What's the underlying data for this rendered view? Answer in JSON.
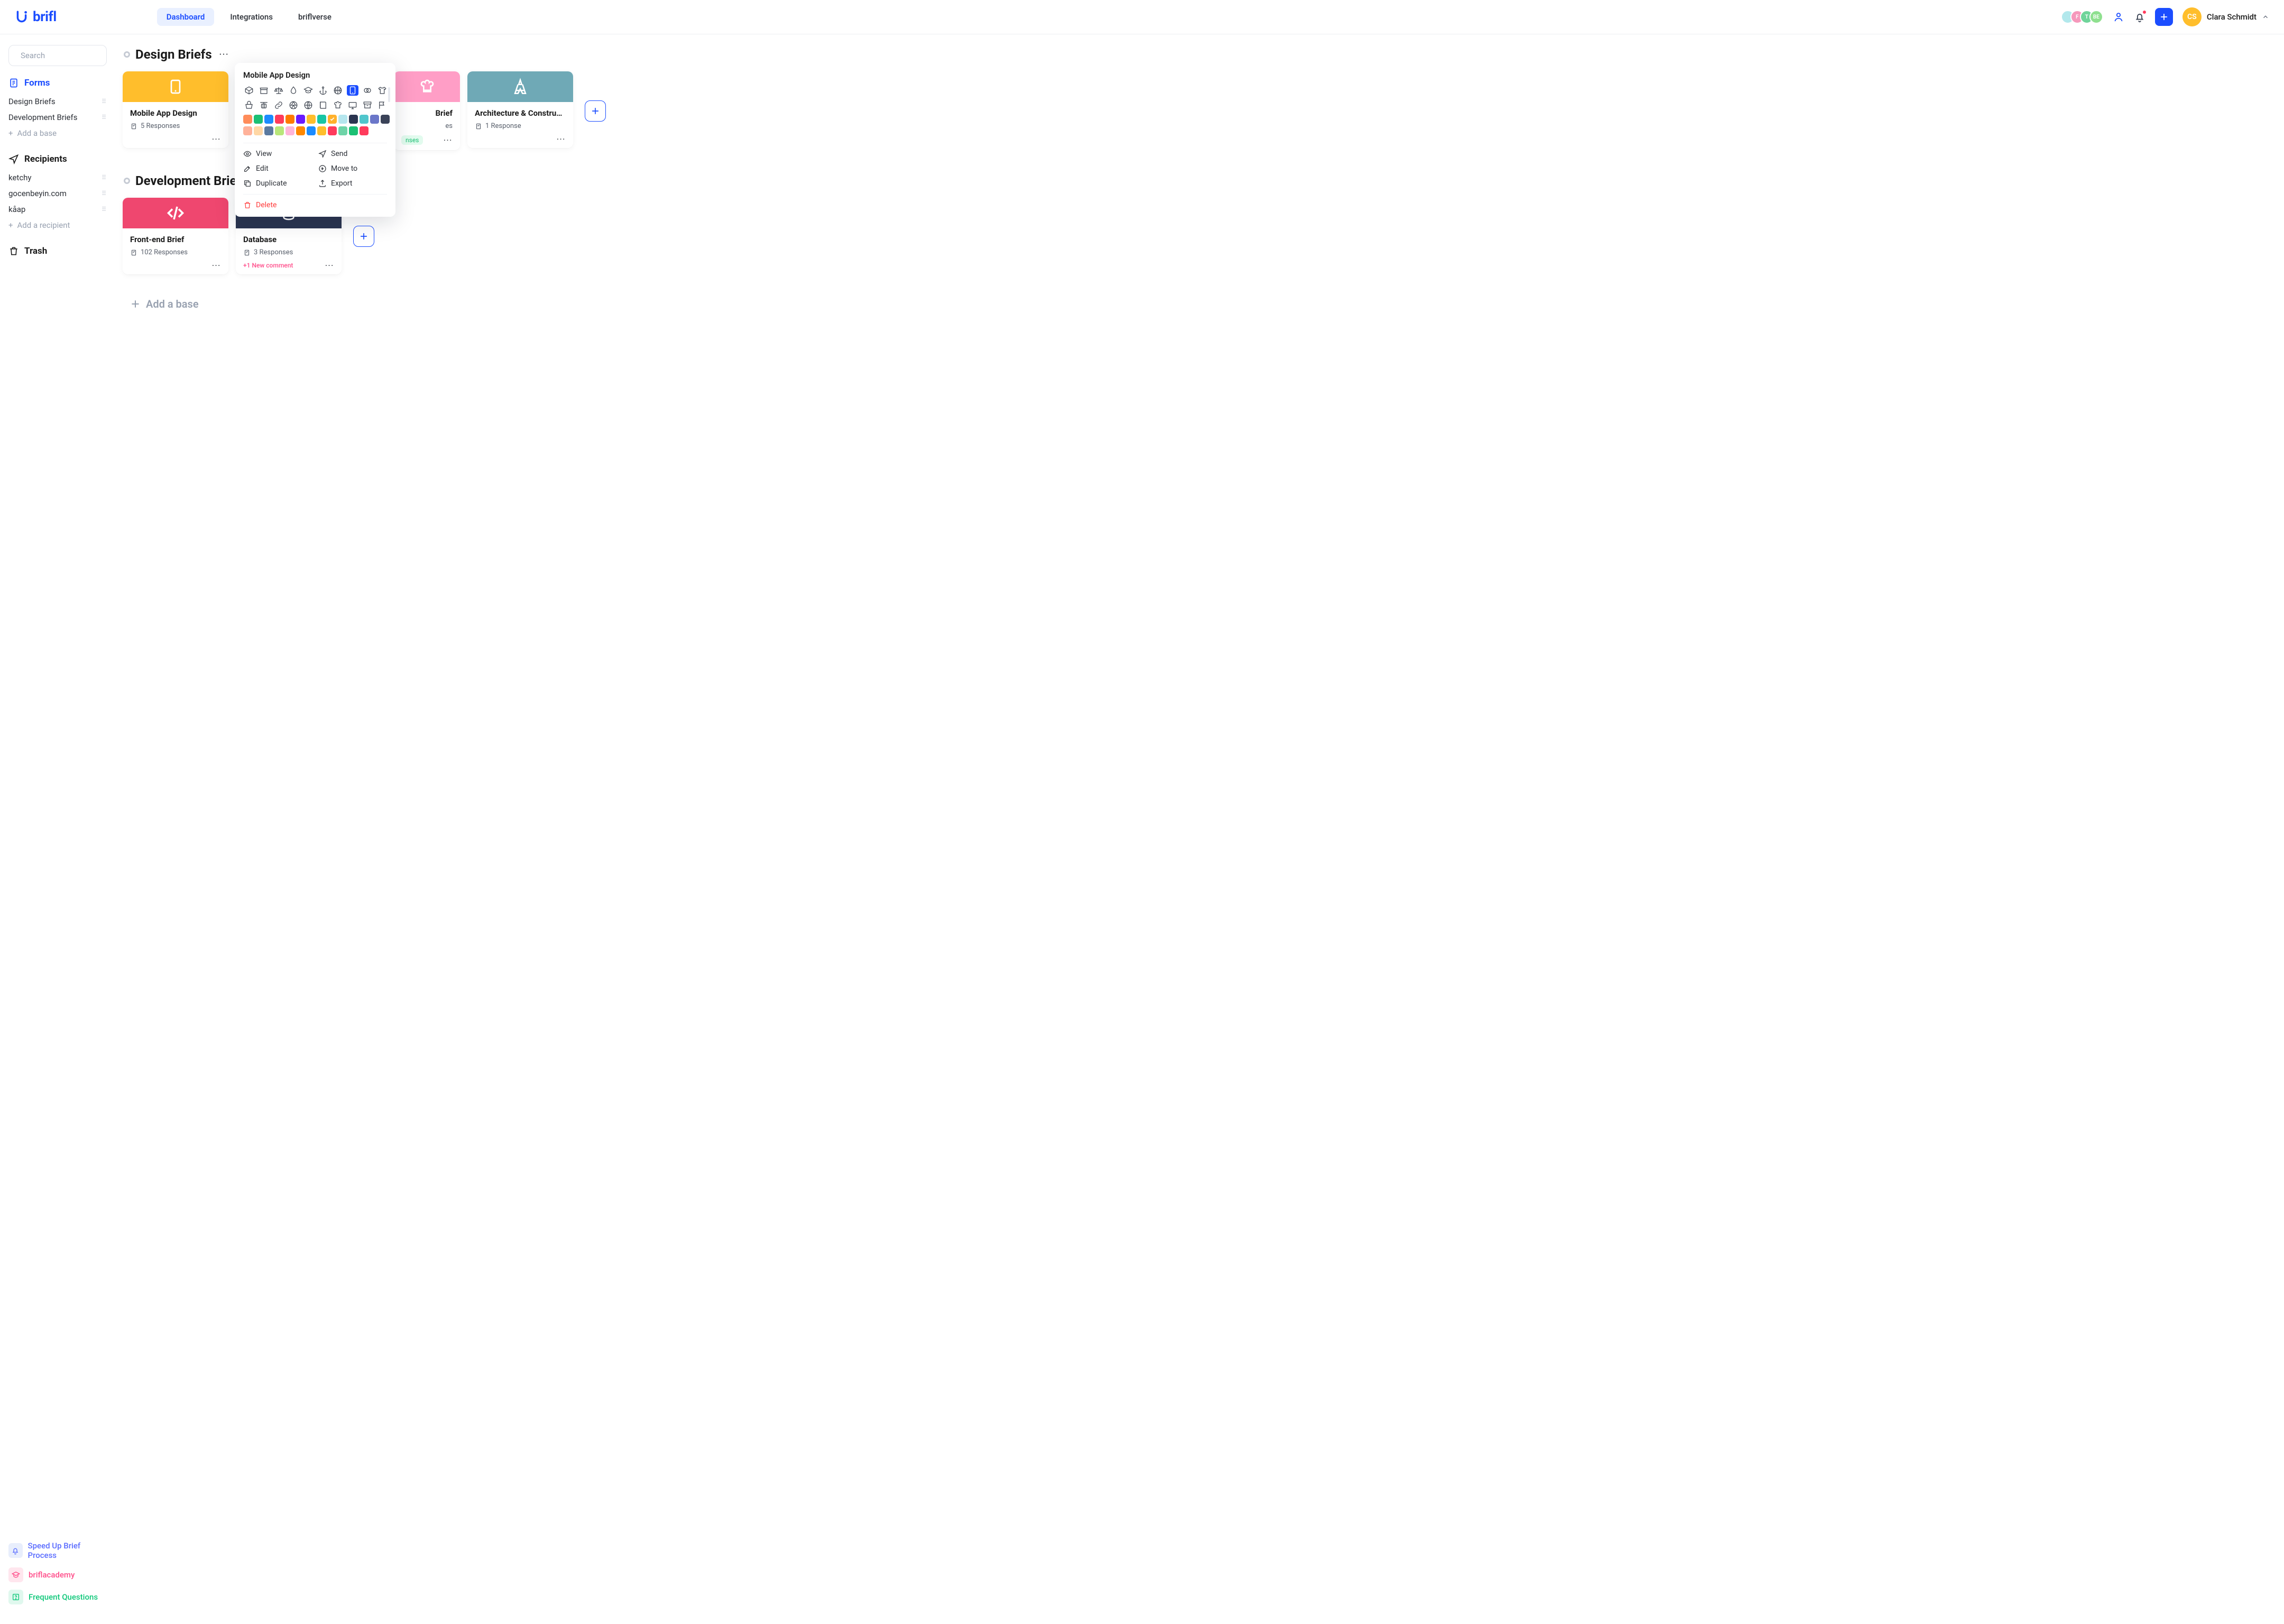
{
  "header": {
    "logo": "brifl",
    "nav": {
      "dashboard": "Dashboard",
      "integrations": "Integrations",
      "briflverse": "briflverse"
    },
    "avatars": [
      "",
      "F",
      "T",
      "BE"
    ],
    "user": {
      "initials": "CS",
      "name": "Clara Schmidt"
    }
  },
  "search": {
    "placeholder": "Search"
  },
  "sidebar": {
    "forms_title": "Forms",
    "forms_items": [
      "Design Briefs",
      "Development Briefs"
    ],
    "add_base": "Add a base",
    "recipients_title": "Recipients",
    "recipients_items": [
      "ketchy",
      "gocenbeyin.com",
      "kåap"
    ],
    "add_recipient": "Add a recipient",
    "trash": "Trash"
  },
  "footer_links": {
    "speed": "Speed Up Brief Process",
    "academy": "briflacademy",
    "faq": "Frequent Questions"
  },
  "sections": {
    "design": {
      "title": "Design Briefs",
      "cards": [
        {
          "title": "Mobile App Design",
          "resp": "5 Responses",
          "color": "#ffbe2c"
        },
        {
          "title": "Brief",
          "resp": "es",
          "color": "#ff9ec6",
          "new_responses": "nses"
        },
        {
          "title": "Architecture & Construc...",
          "resp": "1 Response",
          "color": "#6fa9b6"
        }
      ]
    },
    "dev": {
      "title": "Development Brie",
      "cards": [
        {
          "title": "Front-end Brief",
          "resp": "102 Responses",
          "color": "#ef476f"
        },
        {
          "title": "Database",
          "resp": "3 Responses",
          "color": "#2b3550",
          "new_comment": "+1 New comment"
        }
      ]
    },
    "add_base_main": "Add a base"
  },
  "popover": {
    "title": "Mobile App Design",
    "selectedIconIndex": 7,
    "colors": [
      "#ff8c5a",
      "#1bc074",
      "#1b8cff",
      "#ff3b5c",
      "#ff7a00",
      "#6a1bff",
      "#ffbe2c",
      "#17c6a5",
      "#ffb12c",
      "#b5e6ee",
      "#2b3550",
      "#50c6cc",
      "#6b77c9",
      "#3b4358",
      "#ffb29a",
      "#ffd7a5",
      "#5b7aa0",
      "#b8e67a",
      "#ffb5d9",
      "#ff8800",
      "#1b8cff",
      "#ffbe2c",
      "#ff3b5c",
      "#6ed4a8",
      "#1bc074",
      "#ff3b5c"
    ],
    "selectedColorIndex": 8,
    "actions": {
      "view": "View",
      "edit": "Edit",
      "duplicate": "Duplicate",
      "send": "Send",
      "moveto": "Move to",
      "export": "Export",
      "delete": "Delete"
    }
  }
}
